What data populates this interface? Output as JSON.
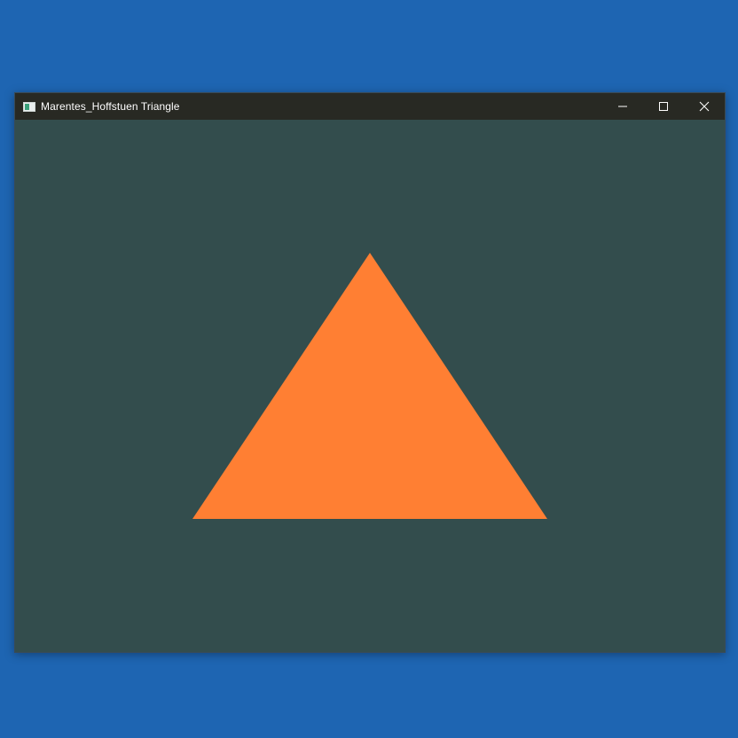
{
  "window": {
    "title": "Marentes_Hoffstuen Triangle",
    "controls": {
      "minimize_icon": "minimize-icon",
      "maximize_icon": "maximize-icon",
      "close_icon": "close-icon"
    }
  },
  "colors": {
    "desktop_background": "#1e65b2",
    "titlebar_background": "#282923",
    "clear_color": "#334d4d",
    "triangle_fill": "#ff7f33"
  },
  "scene": {
    "shape": "triangle",
    "vertices_ndc": [
      [
        -0.5,
        -0.5
      ],
      [
        0.5,
        -0.5
      ],
      [
        0.0,
        0.5
      ]
    ]
  }
}
